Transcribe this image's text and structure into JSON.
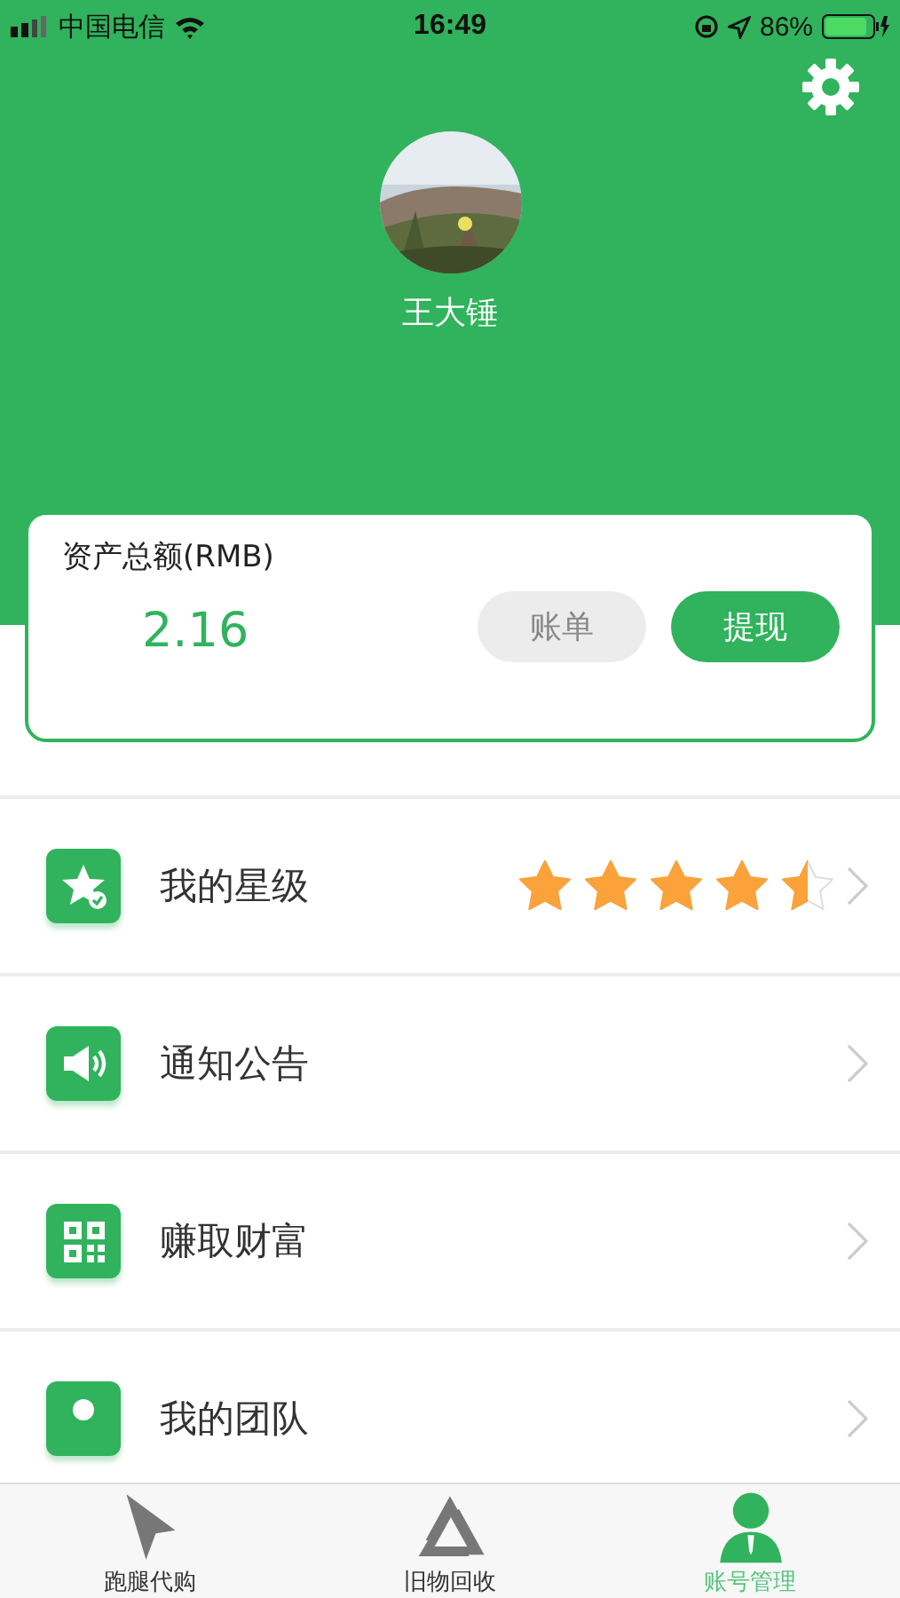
{
  "status_bar": {
    "carrier": "中国电信",
    "time": "16:49",
    "battery": "86%"
  },
  "profile": {
    "name": "王大锤"
  },
  "assets": {
    "label": "资产总额(RMB)",
    "amount": "2.16",
    "buttons": [
      {
        "label": "账单",
        "kind": "secondary"
      },
      {
        "label": "提现",
        "kind": "primary"
      }
    ]
  },
  "menu": [
    {
      "label": "我的星级",
      "kind": "stars",
      "stars": 4.5
    },
    {
      "label": "通知公告",
      "kind": "plain"
    },
    {
      "label": "赚取财富",
      "kind": "plain"
    },
    {
      "label": "我的团队",
      "kind": "plain"
    }
  ],
  "tab_bar": [
    {
      "label": "跑腿代购",
      "selected": false
    },
    {
      "label": "旧物回收",
      "selected": false
    },
    {
      "label": "账号管理",
      "selected": true
    }
  ]
}
